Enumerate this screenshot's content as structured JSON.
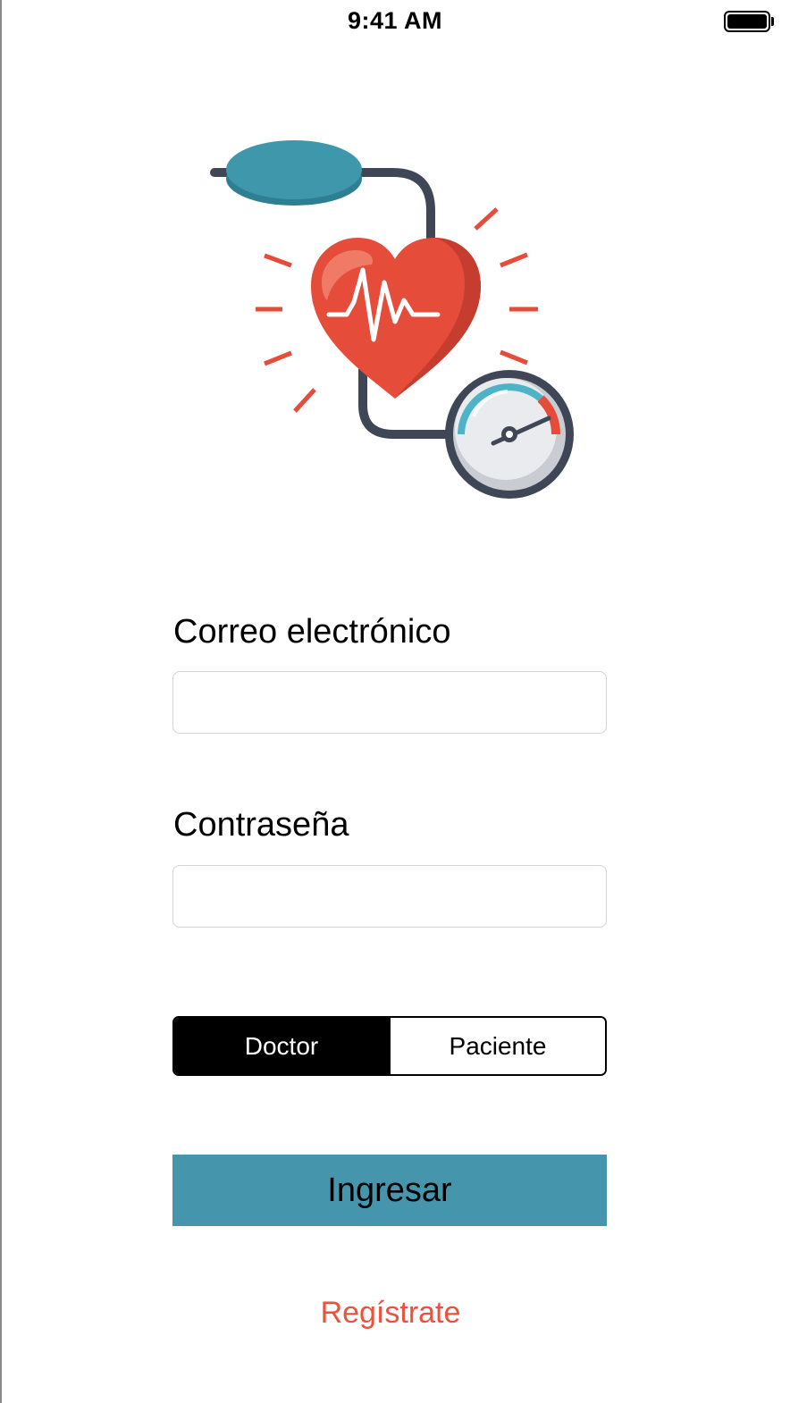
{
  "status_bar": {
    "time": "9:41 AM",
    "battery_icon": "battery-full-icon"
  },
  "logo": {
    "icon": "blood-pressure-heart-icon",
    "colors": {
      "cuff": "#3f97ac",
      "tube": "#3f4656",
      "heart": "#e54c3a",
      "heart_highlight": "#ef7b67",
      "gauge_face": "#e9ebee",
      "gauge_accent": "#4fb3c8"
    }
  },
  "form": {
    "email_label": "Correo electrónico",
    "email_value": "",
    "password_label": "Contraseña",
    "password_value": ""
  },
  "role_selector": {
    "options": [
      "Doctor",
      "Paciente"
    ],
    "selected": "Doctor"
  },
  "login_button": {
    "label": "Ingresar",
    "color": "#4596ac"
  },
  "register_link": {
    "label": "Regístrate",
    "color": "#e8533e"
  }
}
